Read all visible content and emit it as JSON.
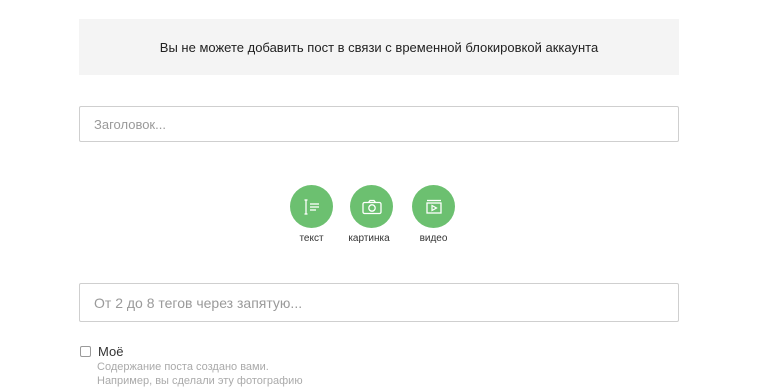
{
  "notice": {
    "text": "Вы не можете добавить пост в связи с временной блокировкой аккаунта"
  },
  "title_field": {
    "placeholder": "Заголовок...",
    "value": ""
  },
  "post_types": [
    {
      "label": "текст",
      "icon": "text-icon"
    },
    {
      "label": "картинка",
      "icon": "camera-icon"
    },
    {
      "label": "видео",
      "icon": "video-icon"
    }
  ],
  "tags_field": {
    "placeholder": "От 2 до 8 тегов через запятую...",
    "value": ""
  },
  "mine_checkbox": {
    "label": "Моё",
    "checked": false,
    "hint_line1": "Содержание поста создано вами.",
    "hint_line2": "Например, вы сделали эту фотографию"
  },
  "colors": {
    "accent": "#6cc070",
    "notice_bg": "#f4f4f4"
  }
}
